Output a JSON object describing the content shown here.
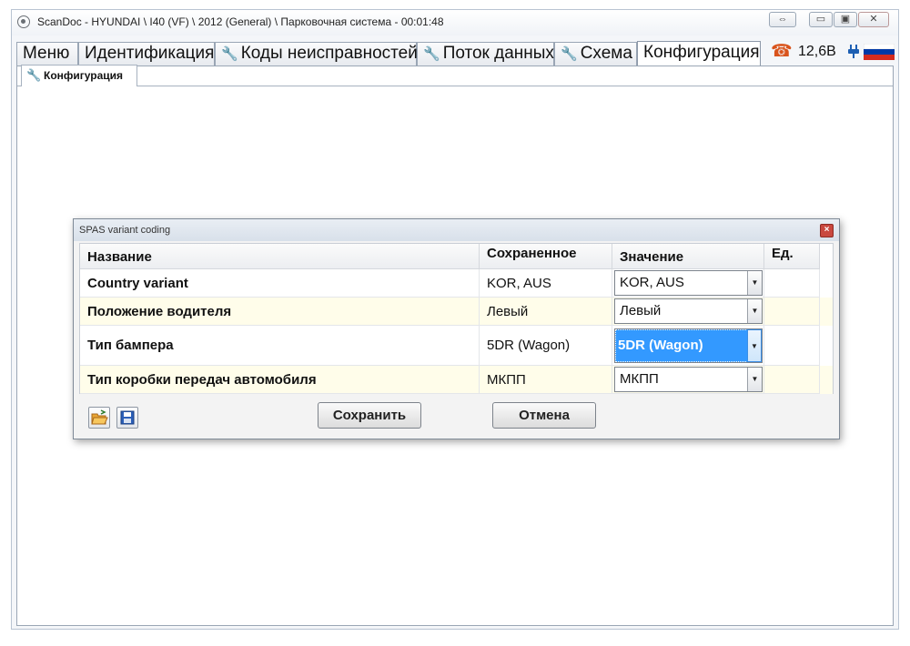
{
  "window": {
    "title": "ScanDoc - HYUNDAI \\ I40 (VF) \\ 2012 (General) \\ Парковочная система - 00:01:48",
    "controls": {
      "restore_arrows": "⇔",
      "minimize": "▭",
      "maximize": "▣",
      "close": "✕"
    }
  },
  "tabs": [
    {
      "label": "Меню",
      "icon": null
    },
    {
      "label": "Идентификация",
      "icon": null
    },
    {
      "label": "Коды неисправностей",
      "icon": "wrench-icon"
    },
    {
      "label": "Поток данных",
      "icon": "wrench-icon"
    },
    {
      "label": "Схема",
      "icon": "wrench-icon"
    },
    {
      "label": "Конфигурация",
      "icon": null,
      "active": true
    }
  ],
  "status": {
    "voltage": "12,6В",
    "icons": [
      "phone-icon",
      "plug-icon",
      "russia-flag-icon"
    ]
  },
  "subtab": {
    "label": "Конфигурация",
    "icon": "wrench-icon"
  },
  "dialog": {
    "title": "SPAS variant coding",
    "columns": {
      "name": "Название",
      "saved": "Сохраненное",
      "value": "Значение",
      "unit": "Ед."
    },
    "rows": [
      {
        "name": "Country variant",
        "saved": "KOR, AUS",
        "value": "KOR, AUS",
        "unit": ""
      },
      {
        "name": "Положение водителя",
        "saved": "Левый",
        "value": "Левый",
        "unit": ""
      },
      {
        "name": "Тип бампера",
        "saved": "5DR (Wagon)",
        "value": "5DR (Wagon)",
        "unit": "",
        "selected": true
      },
      {
        "name": "Тип коробки передач автомобиля",
        "saved": "МКПП",
        "value": "МКПП",
        "unit": ""
      }
    ],
    "buttons": {
      "save": "Сохранить",
      "cancel": "Отмена"
    },
    "tool_icons": [
      "open-folder-icon",
      "floppy-disk-icon"
    ]
  },
  "colors": {
    "selection": "#3399ff",
    "alt_row": "#fffdea",
    "flag_white": "#ffffff",
    "flag_blue": "#0039a6",
    "flag_red": "#d52b1e"
  }
}
